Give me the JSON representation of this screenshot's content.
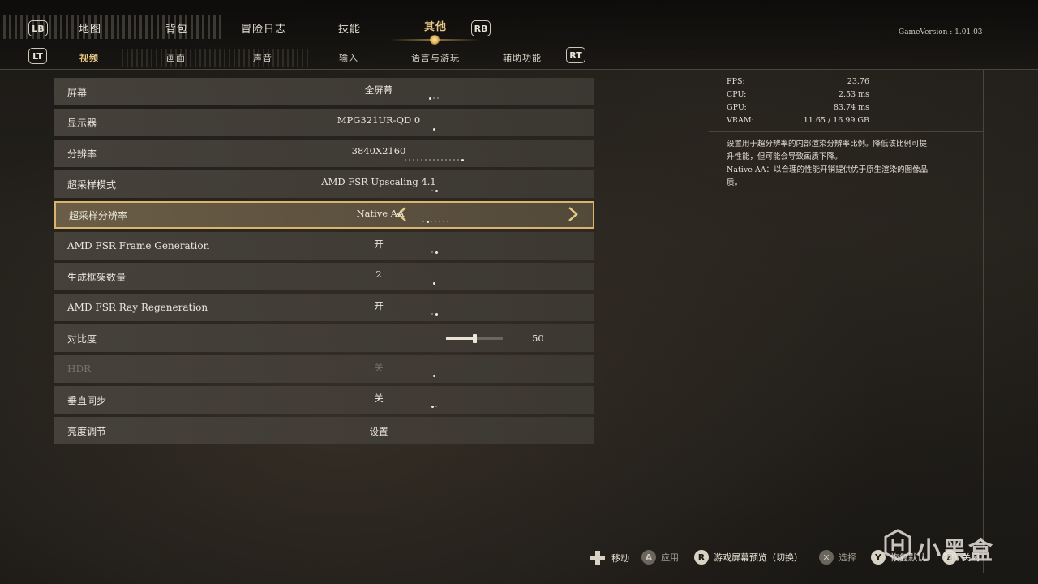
{
  "game_version": "GameVersion : 1.01.03",
  "top_tabs": [
    {
      "label": "地图"
    },
    {
      "label": "背包"
    },
    {
      "label": "冒险日志"
    },
    {
      "label": "技能"
    },
    {
      "label": "其他"
    }
  ],
  "sub_tabs": [
    {
      "label": "视频"
    },
    {
      "label": "画面"
    },
    {
      "label": "声音"
    },
    {
      "label": "输入"
    },
    {
      "label": "语言与游玩"
    },
    {
      "label": "辅助功能"
    }
  ],
  "buttons": {
    "lb": "LB",
    "rb": "RB",
    "lt": "LT",
    "rt": "RT"
  },
  "settings": [
    {
      "label": "屏幕",
      "value": "全屏幕",
      "dots": 3,
      "active_dot": 0
    },
    {
      "label": "显示器",
      "value": "MPG321UR-QD 0",
      "dots": 1,
      "active_dot": 0
    },
    {
      "label": "分辨率",
      "value": "3840X2160",
      "dots": 15,
      "active_dot": 14
    },
    {
      "label": "超采样模式",
      "value": "AMD FSR Upscaling 4.1",
      "dots": 2,
      "active_dot": 1
    },
    {
      "label": "超采样分辨率",
      "value": "Native AA",
      "dots": 7,
      "active_dot": 1
    },
    {
      "label": "AMD FSR Frame Generation",
      "value": "开",
      "dots": 2,
      "active_dot": 1
    },
    {
      "label": "生成框架数量",
      "value": "2",
      "dots": 1,
      "active_dot": 0
    },
    {
      "label": "AMD FSR Ray Regeneration",
      "value": "开",
      "dots": 2,
      "active_dot": 1
    },
    {
      "label": "对比度",
      "value": "50",
      "slider_fraction": 0.5
    },
    {
      "label": "HDR",
      "value": "关",
      "dots": 1,
      "active_dot": 0
    },
    {
      "label": "垂直同步",
      "value": "关",
      "dots": 2,
      "active_dot": 0
    },
    {
      "label": "亮度调节",
      "value": "设置"
    }
  ],
  "stats": [
    {
      "key": "FPS:",
      "value": "23.76"
    },
    {
      "key": "CPU:",
      "value": "2.53 ms"
    },
    {
      "key": "GPU:",
      "value": "83.74 ms"
    },
    {
      "key": "VRAM:",
      "value": "11.65 / 16.99 GB"
    }
  ],
  "description": {
    "line1": "设置用于超分辨率的内部渲染分辨率比例。降低该比例可提",
    "line2": "升性能，但可能会导致画质下降。",
    "line3": "Native AA：以合理的性能开销提供优于原生渲染的图像品",
    "line4": "质。"
  },
  "hints": {
    "move": "移动",
    "apply_btn": "A",
    "apply": "应用",
    "preview_btn": "R",
    "preview": "游戏屏幕预览（切换）",
    "select_btn": "✕",
    "select": "选择",
    "default_btn": "Y",
    "default": "恢复默认",
    "close_btn": "B",
    "close": "关闭"
  },
  "watermark": "小黑盒",
  "colors": {
    "accent": "#d9b46c",
    "active_tab": "#e8c987"
  }
}
